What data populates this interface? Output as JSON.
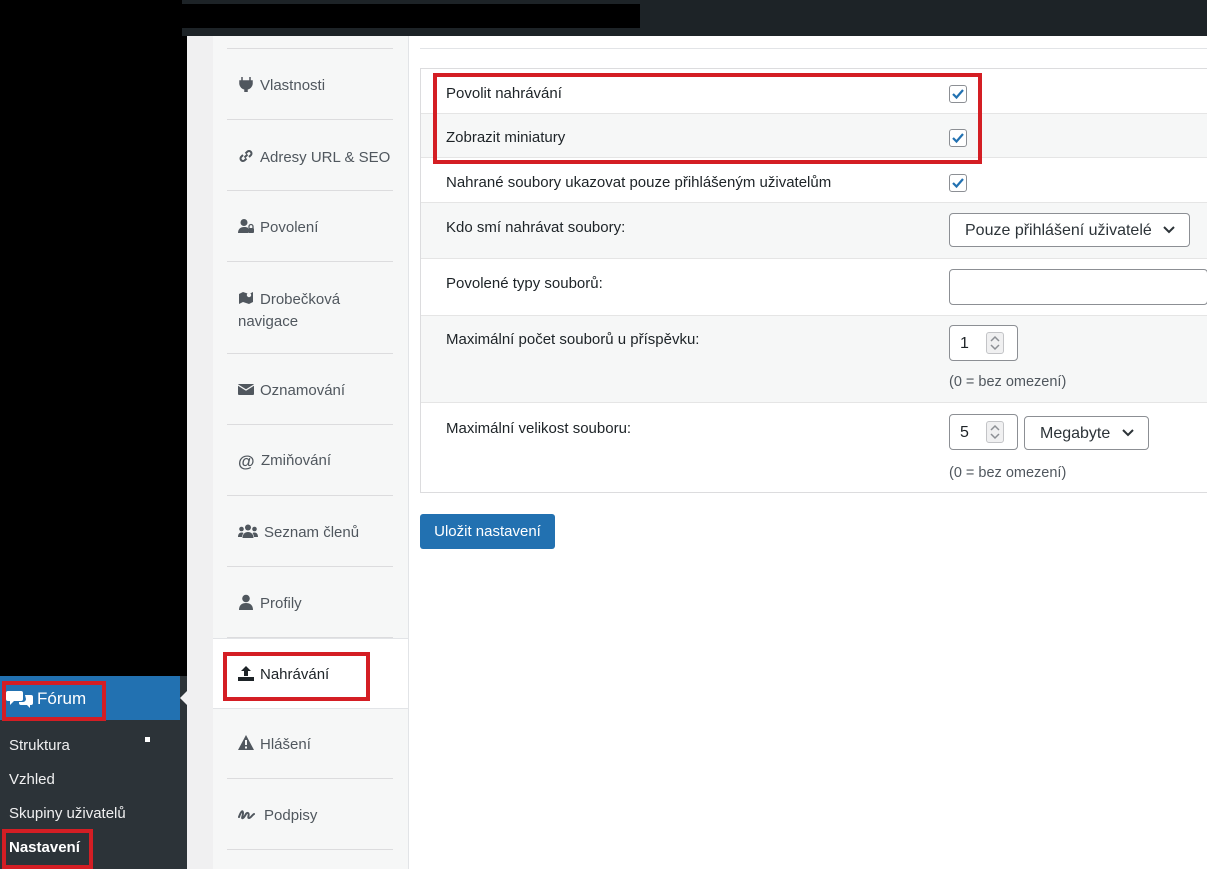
{
  "admin_menu": {
    "forum_label": "Fórum",
    "submenu": [
      "Struktura",
      "Vzhled",
      "Skupiny uživatelů",
      "Nastavení"
    ],
    "active_submenu": "Nastavení"
  },
  "tabs": [
    {
      "label": "Vlastnosti",
      "icon": "plug-icon"
    },
    {
      "label": "Adresy URL & SEO",
      "icon": "link-icon"
    },
    {
      "label": "Povolení",
      "icon": "user-lock-icon"
    },
    {
      "label": "Drobečková navigace",
      "icon": "map-icon"
    },
    {
      "label": "Oznamování",
      "icon": "envelope-icon"
    },
    {
      "label": "Zmiňování",
      "icon": "at-icon"
    },
    {
      "label": "Seznam členů",
      "icon": "users-icon"
    },
    {
      "label": "Profily",
      "icon": "user-icon"
    },
    {
      "label": "Nahrávání",
      "icon": "upload-icon"
    },
    {
      "label": "Hlášení",
      "icon": "warning-icon"
    },
    {
      "label": "Podpisy",
      "icon": "signature-icon"
    }
  ],
  "active_tab": "Nahrávání",
  "settings": {
    "allow_uploads": {
      "label": "Povolit nahrávání",
      "checked": true
    },
    "show_thumbnails": {
      "label": "Zobrazit miniatury",
      "checked": true
    },
    "logged_in_only": {
      "label": "Nahrané soubory ukazovat pouze přihlášeným uživatelům",
      "checked": true
    },
    "who_can_upload": {
      "label": "Kdo smí nahrávat soubory:",
      "value": "Pouze přihlášení uživatelé"
    },
    "allowed_types": {
      "label": "Povolené typy souborů:",
      "value": ""
    },
    "max_files": {
      "label": "Maximální počet souborů u příspěvku:",
      "value": "1",
      "hint": "(0 = bez omezení)"
    },
    "max_size": {
      "label": "Maximální velikost souboru:",
      "value": "5",
      "unit": "Megabyte",
      "hint": "(0 = bez omezení)"
    }
  },
  "save_button": "Uložit nastavení",
  "colors": {
    "accent": "#2271b1",
    "highlight": "#d41e24",
    "admin_bg": "#2c3338"
  }
}
